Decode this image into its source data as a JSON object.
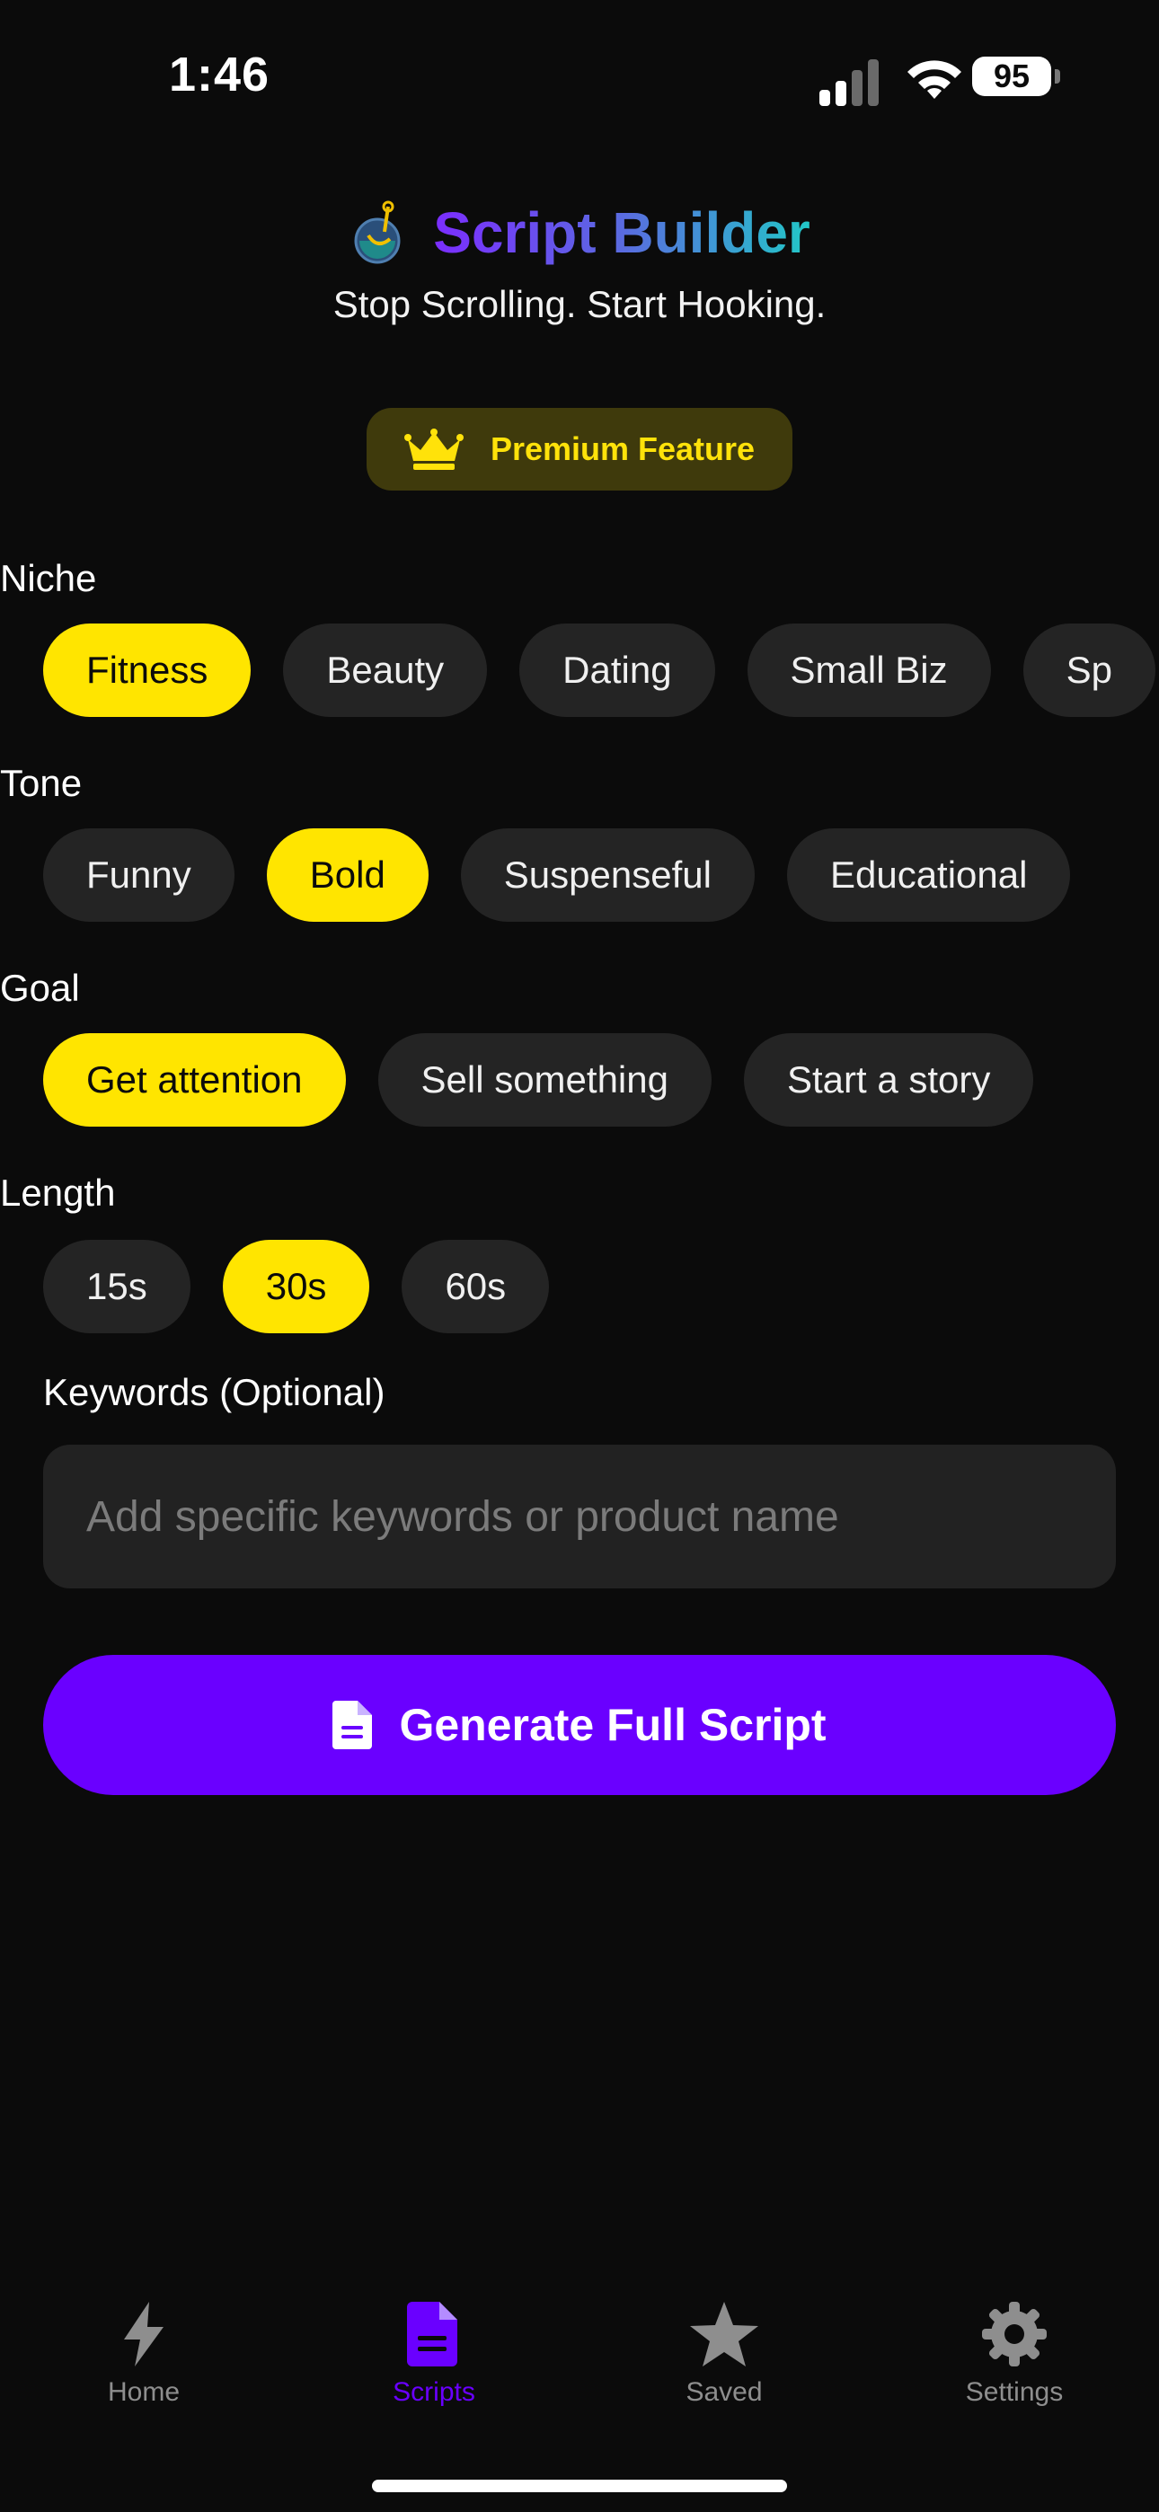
{
  "status_bar": {
    "time": "1:46",
    "battery": "95"
  },
  "header": {
    "title": "Script Builder",
    "tagline": "Stop Scrolling. Start Hooking.",
    "premium_label": "Premium Feature"
  },
  "sections": {
    "niche": {
      "label": "Niche",
      "options": [
        "Fitness",
        "Beauty",
        "Dating",
        "Small Biz",
        "Sp"
      ],
      "selected": "Fitness"
    },
    "tone": {
      "label": "Tone",
      "options": [
        "Funny",
        "Bold",
        "Suspenseful",
        "Educational"
      ],
      "selected": "Bold"
    },
    "goal": {
      "label": "Goal",
      "options": [
        "Get attention",
        "Sell something",
        "Start a story"
      ],
      "selected": "Get attention"
    },
    "length": {
      "label": "Length",
      "options": [
        "15s",
        "30s",
        "60s"
      ],
      "selected": "30s"
    }
  },
  "keywords": {
    "label": "Keywords (Optional)",
    "placeholder": "Add specific keywords or product name",
    "value": ""
  },
  "generate_button": {
    "label": "Generate Full Script",
    "icon": "document-icon"
  },
  "tabbar": {
    "items": [
      {
        "label": "Home",
        "icon": "bolt-icon",
        "active": false
      },
      {
        "label": "Scripts",
        "icon": "document-icon",
        "active": true
      },
      {
        "label": "Saved",
        "icon": "star-icon",
        "active": false
      },
      {
        "label": "Settings",
        "icon": "gear-icon",
        "active": false
      }
    ]
  },
  "colors": {
    "background": "#0b0b0b",
    "chip": "#242424",
    "chip_selected": "#ffe500",
    "accent": "#6a00ff",
    "premium_bg": "#3f3a0c",
    "premium_text": "#ffe20a",
    "tab_inactive": "#8e8e8e"
  }
}
